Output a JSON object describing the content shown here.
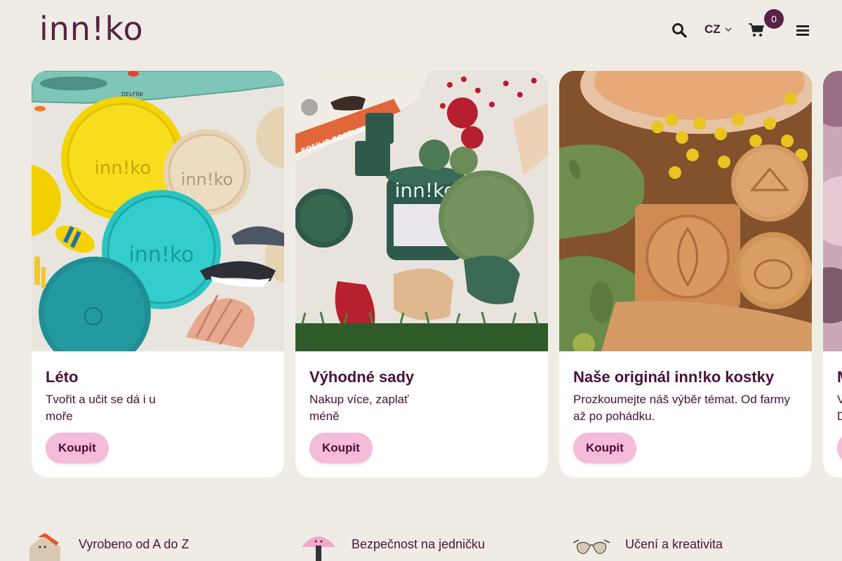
{
  "header": {
    "logo": "inn!ko",
    "language": "CZ",
    "cart_count": "0",
    "icons": [
      "search-icon",
      "chevron-down-icon",
      "cart-icon",
      "menu-icon"
    ]
  },
  "cards": [
    {
      "title": "Léto",
      "description": "Tvořit a učit se dá i u moře",
      "button": "Koupit",
      "image_labels": [
        "inn!ko",
        "inn!ko",
        "inn!ko",
        "DELFÍNI"
      ]
    },
    {
      "title": "Výhodné sady",
      "description": "Nakup více, zaplať méně",
      "button": "Koupit",
      "image_labels": [
        "inn!ko",
        "FOSILIE ROSTLIN A"
      ]
    },
    {
      "title": "Naše originál inn!ko kostky",
      "description": "Prozkoumejte náš výběr témat. Od farmy až po pohádku.",
      "button": "Koupit"
    },
    {
      "title": "M",
      "description": "V D",
      "button": ""
    }
  ],
  "features": [
    {
      "label": "Vyrobeno od A do Z",
      "icon": "house-icon"
    },
    {
      "label": "Bezpečnost na jedničku",
      "icon": "mushroom-icon"
    },
    {
      "label": "Učení a kreativita",
      "icon": "glasses-icon"
    }
  ],
  "colors": {
    "background": "#efebe5",
    "brand": "#5a2146",
    "button": "#f4bcd9",
    "card": "#ffffff"
  }
}
